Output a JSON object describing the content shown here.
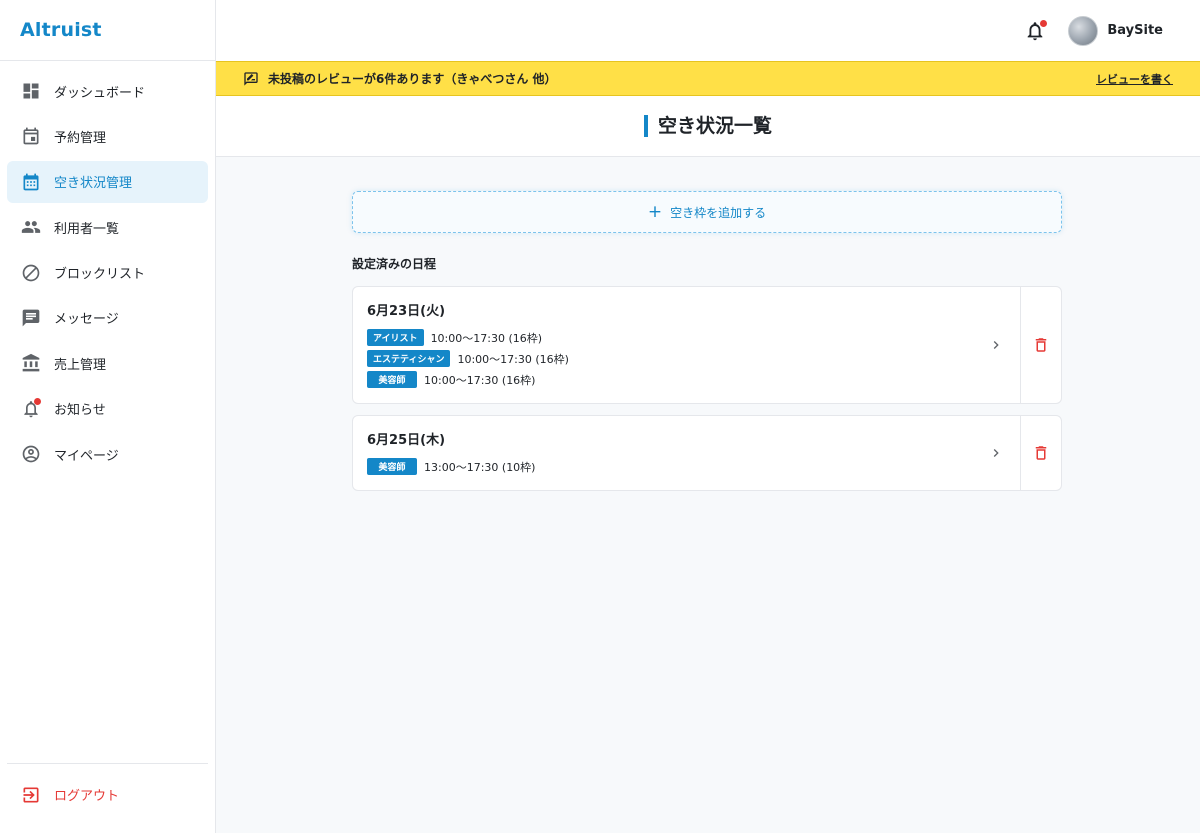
{
  "app": {
    "brand": "Altruist"
  },
  "sidebar": {
    "items": [
      {
        "label": "ダッシュボード",
        "icon": "dashboard-icon"
      },
      {
        "label": "予約管理",
        "icon": "calendar-today-icon"
      },
      {
        "label": "空き状況管理",
        "icon": "calendar-month-icon",
        "active": true
      },
      {
        "label": "利用者一覧",
        "icon": "users-icon"
      },
      {
        "label": "ブロックリスト",
        "icon": "block-icon"
      },
      {
        "label": "メッセージ",
        "icon": "message-icon"
      },
      {
        "label": "売上管理",
        "icon": "bank-icon"
      },
      {
        "label": "お知らせ",
        "icon": "bell-icon",
        "has_badge": true
      },
      {
        "label": "マイページ",
        "icon": "account-circle-icon"
      }
    ],
    "logout_label": "ログアウト"
  },
  "header": {
    "username": "BaySite",
    "has_notification": true
  },
  "banner": {
    "message": "未投稿のレビューが6件あります（きゃべつさん 他）",
    "link": "レビューを書く"
  },
  "page": {
    "title": "空き状況一覧",
    "add_button": "空き枠を追加する",
    "section_title": "設定済みの日程"
  },
  "schedules": [
    {
      "date": "6月23日(火)",
      "slots": [
        {
          "role": "アイリスト",
          "time": "10:00〜17:30 (16枠)"
        },
        {
          "role": "エステティシャン",
          "time": "10:00〜17:30 (16枠)"
        },
        {
          "role": "美容師",
          "time": "10:00〜17:30 (16枠)"
        }
      ]
    },
    {
      "date": "6月25日(木)",
      "slots": [
        {
          "role": "美容師",
          "time": "13:00〜17:30 (10枠)"
        }
      ]
    }
  ],
  "colors": {
    "accent": "#1487c8",
    "banner": "#ffe047",
    "danger": "#e53935"
  }
}
